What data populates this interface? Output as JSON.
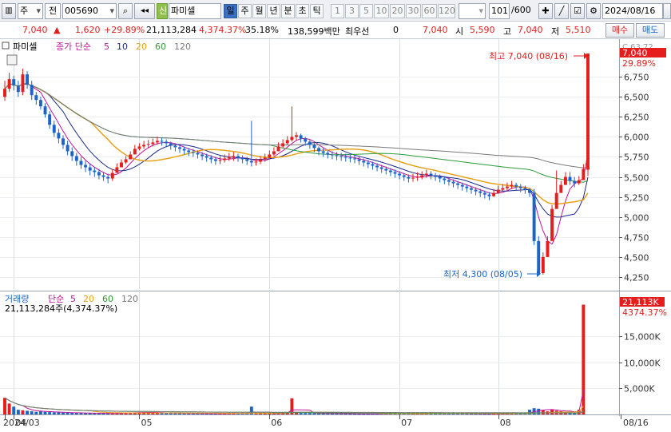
{
  "toolbar": {
    "market": "주",
    "type": "전",
    "code": "005690",
    "new_badge": "신",
    "name": "파미셀",
    "periods": [
      "일",
      "주",
      "월",
      "년",
      "분",
      "초",
      "틱"
    ],
    "active_period": "일",
    "numbers": [
      "1",
      "3",
      "5",
      "10",
      "20",
      "30",
      "60",
      "120"
    ],
    "count": "101",
    "count_total": "/600",
    "date": "2024/08/16"
  },
  "quote": {
    "price": "7,040",
    "arrow": "▲",
    "change": "1,620",
    "change_pct": "+29.89%",
    "volume": "21,113,284",
    "volume_pct": "4,374.37%",
    "turnover": "35.18%",
    "amount": "138,599백만",
    "pref_label": "최우선",
    "pref_value": "0",
    "ask": "7,040",
    "open_label": "시",
    "open": "5,590",
    "high_label": "고",
    "high": "7,040",
    "low_label": "저",
    "low": "5,510",
    "buy_button": "매수",
    "sell_button": "매도"
  },
  "chart_meta": {
    "price_legend_name": "파미셀",
    "price_legend_ma": "종가 단순",
    "ma_periods": [
      "5",
      "10",
      "20",
      "60",
      "120"
    ],
    "ma_colors": [
      "#c0149c",
      "#1c2a8c",
      "#e8a21a",
      "#2e9a3a",
      "#7a7a7a"
    ],
    "volume_legend_name": "거래량",
    "volume_legend_ma": "단순",
    "volume_ma_periods": [
      "5",
      "20",
      "60",
      "120"
    ],
    "volume_ma_colors": [
      "#c0149c",
      "#e8a21a",
      "#2e9a3a",
      "#7a7a7a"
    ],
    "volume_info": "21,113,284주(4,374.37%)",
    "high_note": "최고 7,040 (08/16)",
    "low_note": "최저 4,300 (08/05)",
    "price_tag_top": "C 63.72",
    "price_tag": "7,040",
    "price_tag_pct": "29.89%",
    "vol_tag": "21,113K",
    "vol_tag_pct": "4374.37%",
    "up_color": "#e51d1d",
    "down_color": "#1c64c8"
  },
  "chart_data": {
    "type": "candlestick",
    "price_axis_ticks": [
      "6,750",
      "6,500",
      "6,250",
      "6,000",
      "5,750",
      "5,500",
      "5,250",
      "5,000",
      "4,750",
      "4,500",
      "4,250"
    ],
    "price_axis_values": [
      6750,
      6500,
      6250,
      6000,
      5750,
      5500,
      5250,
      5000,
      4750,
      4500,
      4250
    ],
    "price_range": [
      4180,
      7100
    ],
    "volume_axis_ticks": [
      "15,000K",
      "10,000K",
      "5,000K"
    ],
    "volume_axis_values": [
      15000,
      10000,
      5000
    ],
    "volume_range": [
      0,
      21500
    ],
    "x_labels": [
      "2024/03",
      "04",
      "05",
      "06",
      "07",
      "08",
      "08/16"
    ],
    "x_label_index": [
      0,
      2,
      30,
      59,
      88,
      110,
      130
    ],
    "closes": [
      6600,
      6720,
      6640,
      6560,
      6780,
      6650,
      6520,
      6460,
      6380,
      6280,
      6150,
      6050,
      5980,
      5900,
      5820,
      5760,
      5700,
      5650,
      5620,
      5580,
      5560,
      5520,
      5500,
      5480,
      5550,
      5620,
      5680,
      5720,
      5780,
      5850,
      5880,
      5900,
      5910,
      5930,
      5950,
      5940,
      5920,
      5890,
      5870,
      5850,
      5830,
      5810,
      5800,
      5780,
      5760,
      5740,
      5720,
      5700,
      5710,
      5730,
      5750,
      5760,
      5740,
      5720,
      5700,
      5680,
      5690,
      5720,
      5740,
      5780,
      5820,
      5880,
      5920,
      5960,
      6000,
      6020,
      5980,
      5940,
      5900,
      5860,
      5820,
      5800,
      5780,
      5770,
      5760,
      5750,
      5740,
      5730,
      5720,
      5700,
      5680,
      5660,
      5640,
      5620,
      5600,
      5580,
      5560,
      5540,
      5520,
      5500,
      5480,
      5490,
      5500,
      5520,
      5540,
      5520,
      5500,
      5480,
      5460,
      5440,
      5420,
      5400,
      5380,
      5360,
      5340,
      5320,
      5300,
      5280,
      5260,
      5300,
      5340,
      5360,
      5380,
      5400,
      5380,
      5360,
      5340,
      5300,
      4700,
      4300,
      4500,
      4700,
      5100,
      5300,
      5400,
      5500,
      5450,
      5420,
      5460,
      5600,
      7040
    ],
    "opens": [
      6500,
      6600,
      6720,
      6640,
      6560,
      6780,
      6650,
      6520,
      6460,
      6380,
      6280,
      6150,
      6050,
      5980,
      5900,
      5820,
      5760,
      5700,
      5650,
      5620,
      5580,
      5560,
      5520,
      5500,
      5480,
      5550,
      5620,
      5680,
      5720,
      5780,
      5850,
      5880,
      5900,
      5910,
      5930,
      5950,
      5940,
      5920,
      5890,
      5870,
      5850,
      5830,
      5810,
      5800,
      5780,
      5760,
      5740,
      5720,
      5700,
      5710,
      5730,
      5750,
      5760,
      5740,
      5720,
      5700,
      5680,
      5690,
      5720,
      5740,
      5780,
      5820,
      5880,
      5920,
      5960,
      6000,
      6020,
      5980,
      5940,
      5900,
      5860,
      5820,
      5800,
      5780,
      5770,
      5760,
      5750,
      5740,
      5730,
      5720,
      5700,
      5680,
      5660,
      5640,
      5620,
      5600,
      5580,
      5560,
      5540,
      5520,
      5500,
      5480,
      5490,
      5500,
      5520,
      5540,
      5520,
      5500,
      5480,
      5460,
      5440,
      5420,
      5400,
      5380,
      5360,
      5340,
      5320,
      5300,
      5280,
      5260,
      5300,
      5340,
      5360,
      5380,
      5400,
      5380,
      5360,
      5340,
      5300,
      4700,
      4300,
      4500,
      4700,
      5100,
      5300,
      5400,
      5500,
      5450,
      5420,
      5460,
      5590
    ],
    "highs": [
      6700,
      6800,
      6760,
      6700,
      6850,
      6820,
      6700,
      6560,
      6500,
      6420,
      6320,
      6200,
      6100,
      6020,
      5950,
      5870,
      5800,
      5750,
      5700,
      5660,
      5620,
      5600,
      5560,
      5540,
      5600,
      5670,
      5720,
      5760,
      5820,
      5900,
      5920,
      5950,
      5960,
      5980,
      6000,
      5990,
      5970,
      5940,
      5920,
      5900,
      5880,
      5860,
      5850,
      5830,
      5810,
      5790,
      5770,
      5750,
      5760,
      5780,
      5800,
      5810,
      5790,
      5770,
      5750,
      6200,
      5730,
      5760,
      5790,
      5830,
      5870,
      5930,
      5970,
      6010,
      6380,
      6060,
      6040,
      6000,
      5960,
      5920,
      5880,
      5860,
      5830,
      5820,
      5810,
      5800,
      5790,
      5780,
      5770,
      5750,
      5730,
      5710,
      5690,
      5670,
      5650,
      5630,
      5610,
      5590,
      5570,
      5550,
      5530,
      5540,
      5560,
      5570,
      5590,
      5570,
      5550,
      5530,
      5510,
      5490,
      5470,
      5450,
      5430,
      5410,
      5390,
      5370,
      5350,
      5330,
      5310,
      5350,
      5390,
      5410,
      5430,
      5450,
      5430,
      5410,
      5390,
      5360,
      5350,
      4760,
      4560,
      4760,
      5150,
      5580,
      5450,
      5560,
      5560,
      5500,
      5510,
      5660,
      7040
    ],
    "lows": [
      6450,
      6560,
      6580,
      6500,
      6520,
      6600,
      6460,
      6400,
      6340,
      6240,
      6100,
      6000,
      5920,
      5850,
      5770,
      5700,
      5640,
      5600,
      5560,
      5520,
      5500,
      5470,
      5450,
      5420,
      5450,
      5560,
      5620,
      5660,
      5720,
      5800,
      5830,
      5850,
      5860,
      5880,
      5900,
      5890,
      5870,
      5840,
      5820,
      5800,
      5780,
      5760,
      5750,
      5730,
      5710,
      5690,
      5670,
      5650,
      5660,
      5680,
      5700,
      5700,
      5690,
      5670,
      5650,
      5630,
      5640,
      5660,
      5690,
      5720,
      5760,
      5820,
      5860,
      5900,
      5940,
      5960,
      5930,
      5890,
      5850,
      5810,
      5770,
      5750,
      5730,
      5720,
      5710,
      5700,
      5690,
      5680,
      5670,
      5650,
      5630,
      5610,
      5590,
      5570,
      5550,
      5530,
      5510,
      5490,
      5470,
      5450,
      5430,
      5440,
      5450,
      5470,
      5490,
      5470,
      5450,
      5430,
      5410,
      5390,
      5370,
      5350,
      5330,
      5310,
      5290,
      5270,
      5250,
      5230,
      5210,
      5250,
      5290,
      5310,
      5330,
      5350,
      5330,
      5310,
      5290,
      5250,
      4650,
      4280,
      4280,
      4640,
      5050,
      5250,
      5340,
      5440,
      5400,
      5370,
      5400,
      5510,
      5510
    ],
    "volumes": [
      3200,
      2100,
      1500,
      900,
      800,
      700,
      600,
      500,
      600,
      500,
      450,
      400,
      380,
      350,
      320,
      300,
      280,
      260,
      250,
      240,
      230,
      220,
      210,
      200,
      220,
      260,
      300,
      320,
      340,
      380,
      400,
      420,
      380,
      340,
      300,
      280,
      260,
      240,
      220,
      200,
      190,
      180,
      170,
      160,
      150,
      140,
      130,
      140,
      150,
      160,
      180,
      200,
      190,
      180,
      170,
      1500,
      160,
      170,
      190,
      210,
      240,
      280,
      320,
      360,
      3100,
      300,
      280,
      260,
      240,
      220,
      200,
      190,
      180,
      170,
      160,
      150,
      140,
      130,
      120,
      110,
      100,
      110,
      120,
      130,
      140,
      150,
      160,
      170,
      180,
      190,
      200,
      210,
      220,
      230,
      240,
      230,
      220,
      210,
      200,
      190,
      180,
      170,
      160,
      150,
      140,
      130,
      120,
      110,
      100,
      120,
      140,
      160,
      180,
      200,
      190,
      180,
      170,
      900,
      1200,
      1100,
      800,
      600,
      1000,
      700,
      600,
      500,
      400,
      350,
      900,
      21113
    ]
  }
}
